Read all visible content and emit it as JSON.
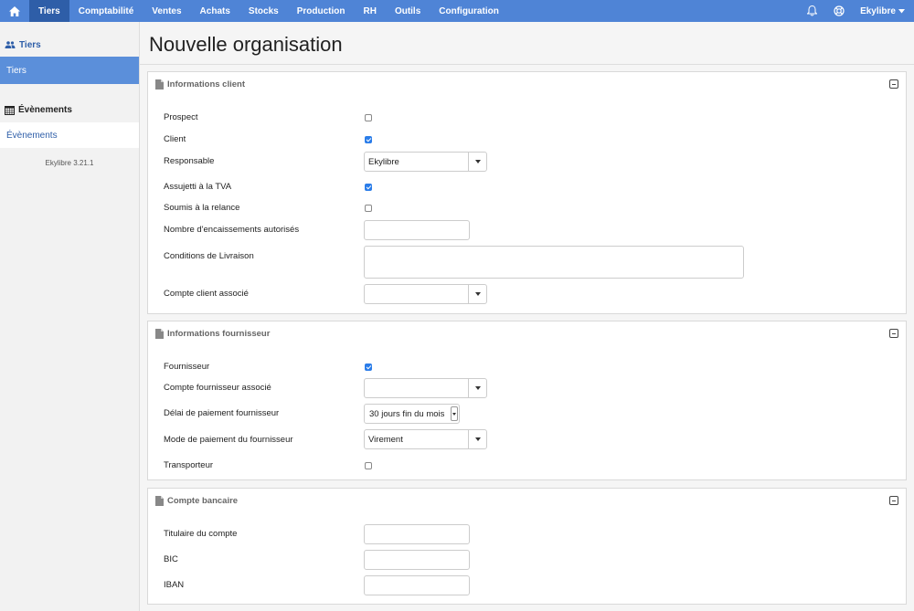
{
  "nav": {
    "items": [
      "Tiers",
      "Comptabilité",
      "Ventes",
      "Achats",
      "Stocks",
      "Production",
      "RH",
      "Outils",
      "Configuration"
    ],
    "active_index": 0,
    "user": "Ekylibre"
  },
  "sidebar": {
    "tiers_section": "Tiers",
    "tiers_active": "Tiers",
    "events_section": "Évènements",
    "events_link": "Évènements",
    "version": "Ekylibre 3.21.1"
  },
  "page": {
    "title": "Nouvelle organisation"
  },
  "client_panel": {
    "title": "Informations client",
    "prospect": "Prospect",
    "client": "Client",
    "responsable": "Responsable",
    "responsable_value": "Ekylibre",
    "assujetti": "Assujetti à la TVA",
    "relance": "Soumis à la relance",
    "encaissements": "Nombre d'encaissements autorisés",
    "livraison": "Conditions de Livraison",
    "compte_client": "Compte client associé"
  },
  "supplier_panel": {
    "title": "Informations fournisseur",
    "fournisseur": "Fournisseur",
    "compte_fournisseur": "Compte fournisseur associé",
    "delai": "Délai de paiement fournisseur",
    "delai_value": "30 jours fin du mois",
    "mode": "Mode de paiement du fournisseur",
    "mode_value": "Virement",
    "transporteur": "Transporteur"
  },
  "bank_panel": {
    "title": "Compte bancaire",
    "titulaire": "Titulaire du compte",
    "bic": "BIC",
    "iban": "IBAN"
  },
  "checkboxes": {
    "prospect": false,
    "client": true,
    "assujetti": true,
    "relance": false,
    "fournisseur": true,
    "transporteur": false
  },
  "colors": {
    "nav_bg": "#4f84d6",
    "nav_active": "#2e5ea8",
    "sidebar_active": "#5b8fda",
    "checkbox": "#2b7de9"
  }
}
